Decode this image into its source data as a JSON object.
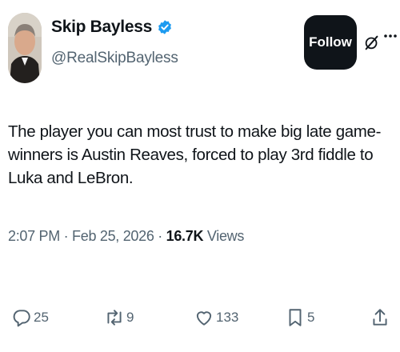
{
  "author": {
    "display_name": "Skip Bayless",
    "handle": "@RealSkipBayless",
    "verified": true
  },
  "follow_label": "Follow",
  "tweet": {
    "text": "The player you can most trust to make big late game-winners is Austin Reaves, forced to play 3rd fiddle to Luka and LeBron."
  },
  "meta": {
    "time": "2:07 PM",
    "separator1": " · ",
    "date": "Feb 25, 2026",
    "separator2": " · ",
    "views_count": "16.7K",
    "views_label": " Views"
  },
  "actions": {
    "replies": "25",
    "reposts": "9",
    "likes": "133",
    "bookmarks": "5"
  },
  "icons": [
    "verified-badge-icon",
    "grok-icon",
    "more-icon",
    "reply-icon",
    "repost-icon",
    "like-icon",
    "bookmark-icon",
    "share-icon"
  ],
  "colors": {
    "text": "#0f1419",
    "secondary": "#536471",
    "verified": "#1d9bf0",
    "follow_bg": "#0f1419"
  }
}
